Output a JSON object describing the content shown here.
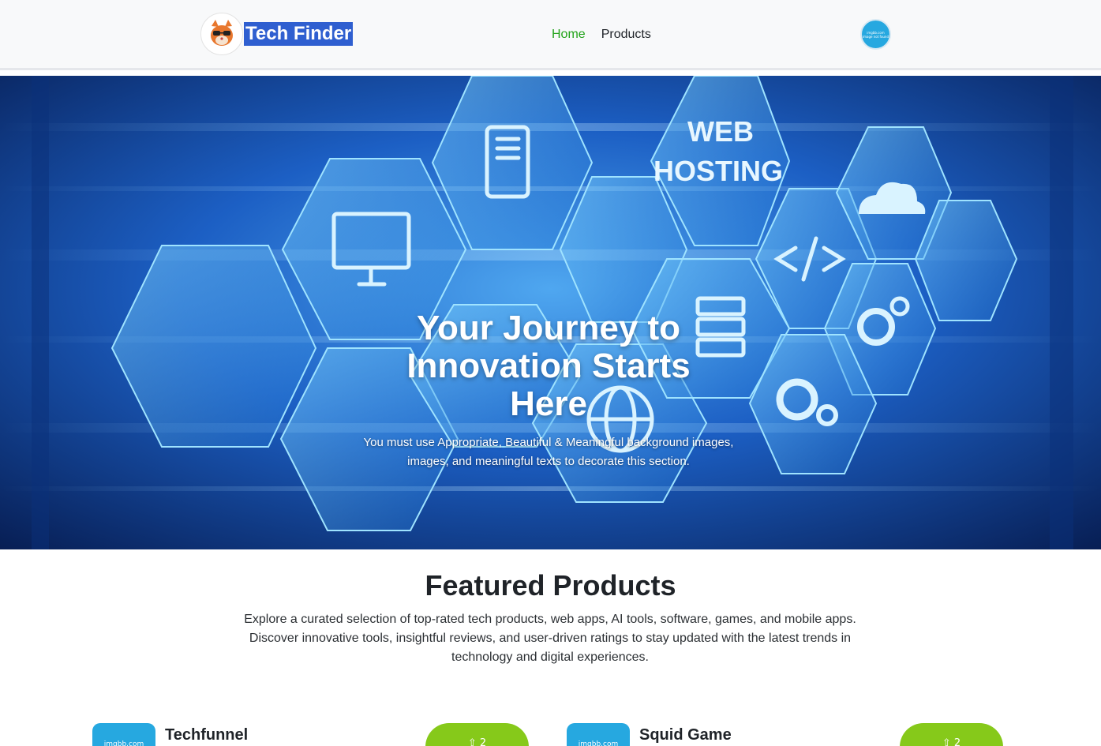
{
  "navbar": {
    "brand": "Tech Finder",
    "links": [
      {
        "label": "Home",
        "active": true
      },
      {
        "label": "Products",
        "active": false
      }
    ],
    "avatar_text_line1": "imgbb.com",
    "avatar_text_line2": "image not found"
  },
  "hero": {
    "title": "Your Journey to Innovation Starts Here",
    "subtitle": "You must use Appropriate, Beautiful & Meaningful background images, images, and meaningful texts to decorate this section.",
    "hex_label_line1": "WEB",
    "hex_label_line2": "HOSTING"
  },
  "featured": {
    "title": "Featured Products",
    "description": "Explore a curated selection of top-rated tech products, web apps, AI tools, software, games, and mobile apps. Discover innovative tools, insightful reviews, and user-driven ratings to stay updated with the latest trends in technology and digital experiences."
  },
  "products": [
    {
      "name": "Techfunnel",
      "thumb_text": "imgbb.com",
      "votes": "2"
    },
    {
      "name": "Squid Game",
      "thumb_text": "imgbb.com",
      "votes": "2"
    }
  ],
  "colors": {
    "accent_green": "#22a319",
    "vote_green": "#86c91a",
    "brand_blue": "#2f5fd0",
    "thumb_blue": "#26a8e0"
  }
}
